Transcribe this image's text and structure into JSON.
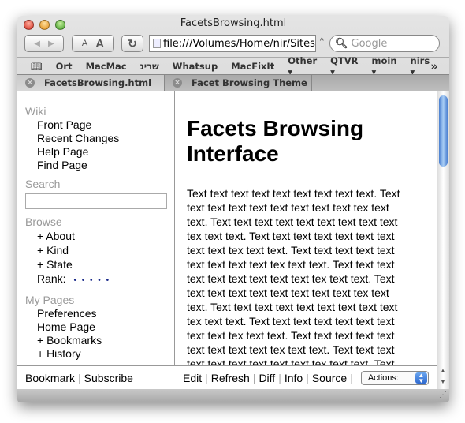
{
  "window": {
    "title": "FacetsBrowsing.html"
  },
  "toolbar": {
    "back_icon": "◀",
    "forward_icon": "▶",
    "text_smaller": "A",
    "text_bigger": "A",
    "reload_icon": "↻",
    "url": "file:///Volumes/Home/nir/Sites/",
    "search_placeholder": "Google"
  },
  "bookmarks": [
    "Ort",
    "MacMac",
    "שריג",
    "Whatsup",
    "MacFixIt",
    "Other ▾",
    "QTVR ▾",
    "moin ▾",
    "nirs ▾"
  ],
  "bookmarks_more": "»",
  "tabs": [
    {
      "label": "FacetsBrowsing.html",
      "active": true
    },
    {
      "label": "Facet Browsing Theme ...",
      "active": false
    }
  ],
  "sidebar": {
    "wiki_heading": "Wiki",
    "wiki_items": [
      "Front Page",
      "Recent Changes",
      "Help Page",
      "Find Page"
    ],
    "search_heading": "Search",
    "search_value": "",
    "browse_heading": "Browse",
    "browse_items": [
      "+ About",
      "+ Kind",
      "+ State"
    ],
    "rank_label": "Rank:",
    "rank_dots": "• • • • •",
    "mypages_heading": "My Pages",
    "mypages_items": [
      "Preferences",
      "Home Page",
      "+ Bookmarks",
      "+ History"
    ],
    "footer_links": [
      "Bookmark",
      "Subscribe"
    ]
  },
  "main": {
    "title_line1": "Facets Browsing",
    "title_line2": "Interface",
    "lines": [
      "Text text text text text text text text text. Text",
      "text text text text text text text text tex text",
      "text. Text text text text text text text text text",
      "tex text text. Text text text text text text text",
      "text text tex text text. Text text text text text",
      "text text text text tex text text. Text text text",
      "text text text text text text tex text text. Text",
      "text text text text text text text text tex text",
      "text. Text text text text text text text text text",
      "tex text text. Text text text text text text text",
      "text text tex text text. Text text text text text",
      "text text text text tex text text. Text text text",
      "text text text text text text tex text text. Text"
    ],
    "footer_links": [
      "Edit",
      "Refresh",
      "Diff",
      "Info",
      "Source"
    ],
    "actions_label": "Actions:"
  },
  "colors": {
    "heading_gray": "#999999",
    "rank_dots": "#1a2a8a",
    "scroll_thumb": "#4a7fd0"
  }
}
